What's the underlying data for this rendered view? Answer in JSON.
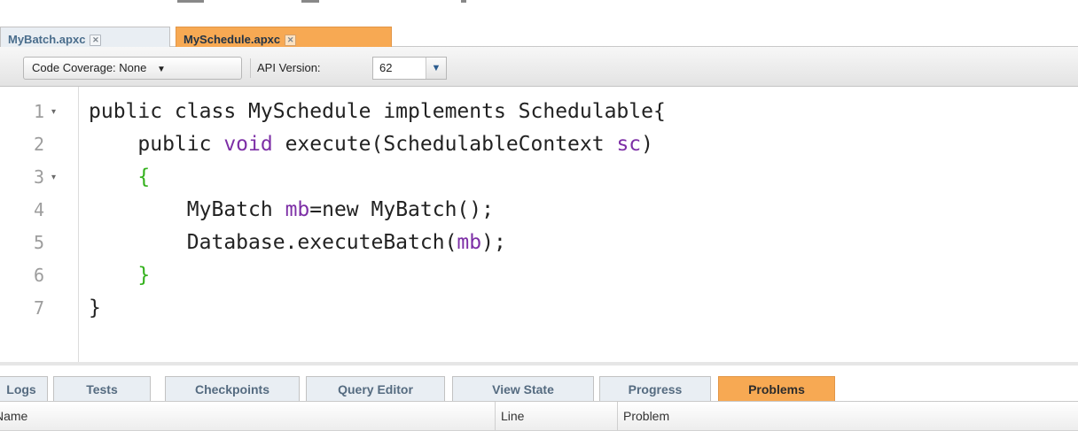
{
  "file_tabs": [
    {
      "label": "MyBatch.apxc",
      "active": false
    },
    {
      "label": "MySchedule.apxc",
      "active": true
    }
  ],
  "toolbar": {
    "coverage_label": "Code Coverage: None",
    "api_label": "API Version:",
    "api_value": "62"
  },
  "editor": {
    "line_numbers": [
      "1",
      "2",
      "3",
      "4",
      "5",
      "6",
      "7"
    ],
    "lines": [
      {
        "segments": [
          {
            "t": "public class MySchedule implements Schedulable{",
            "c": ""
          }
        ]
      },
      {
        "segments": [
          {
            "t": "    public ",
            "c": ""
          },
          {
            "t": "void",
            "c": "kw"
          },
          {
            "t": " execute(SchedulableContext ",
            "c": ""
          },
          {
            "t": "sc",
            "c": "id"
          },
          {
            "t": ")",
            "c": ""
          }
        ]
      },
      {
        "segments": [
          {
            "t": "    ",
            "c": ""
          },
          {
            "t": "{",
            "c": "gb"
          }
        ]
      },
      {
        "segments": [
          {
            "t": "        MyBatch ",
            "c": ""
          },
          {
            "t": "mb",
            "c": "id"
          },
          {
            "t": "=new MyBatch();",
            "c": ""
          }
        ]
      },
      {
        "segments": [
          {
            "t": "        Database.executeBatch(",
            "c": ""
          },
          {
            "t": "mb",
            "c": "id"
          },
          {
            "t": ");",
            "c": ""
          }
        ]
      },
      {
        "segments": [
          {
            "t": "    ",
            "c": ""
          },
          {
            "t": "}",
            "c": "gb"
          }
        ]
      },
      {
        "segments": [
          {
            "t": "}",
            "c": ""
          }
        ]
      }
    ],
    "fold_markers": [
      "▾",
      "",
      "▾",
      "",
      "",
      "",
      ""
    ]
  },
  "panel_tabs": [
    {
      "label": "Logs",
      "active": false
    },
    {
      "label": "Tests",
      "active": false
    },
    {
      "label": "Checkpoints",
      "active": false
    },
    {
      "label": "Query Editor",
      "active": false
    },
    {
      "label": "View State",
      "active": false
    },
    {
      "label": "Progress",
      "active": false
    },
    {
      "label": "Problems",
      "active": true
    }
  ],
  "problems_table": {
    "columns": [
      "Name",
      "Line",
      "Problem"
    ]
  },
  "icons": {
    "tab_close": "close-icon",
    "dropdown": "chevron-down-icon",
    "fold": "fold-arrow-icon"
  },
  "colors": {
    "active_tab": "#f7a953",
    "keyword": "#7d2fa6",
    "brace": "#33b11c",
    "line_number": "#9d9d9d"
  }
}
